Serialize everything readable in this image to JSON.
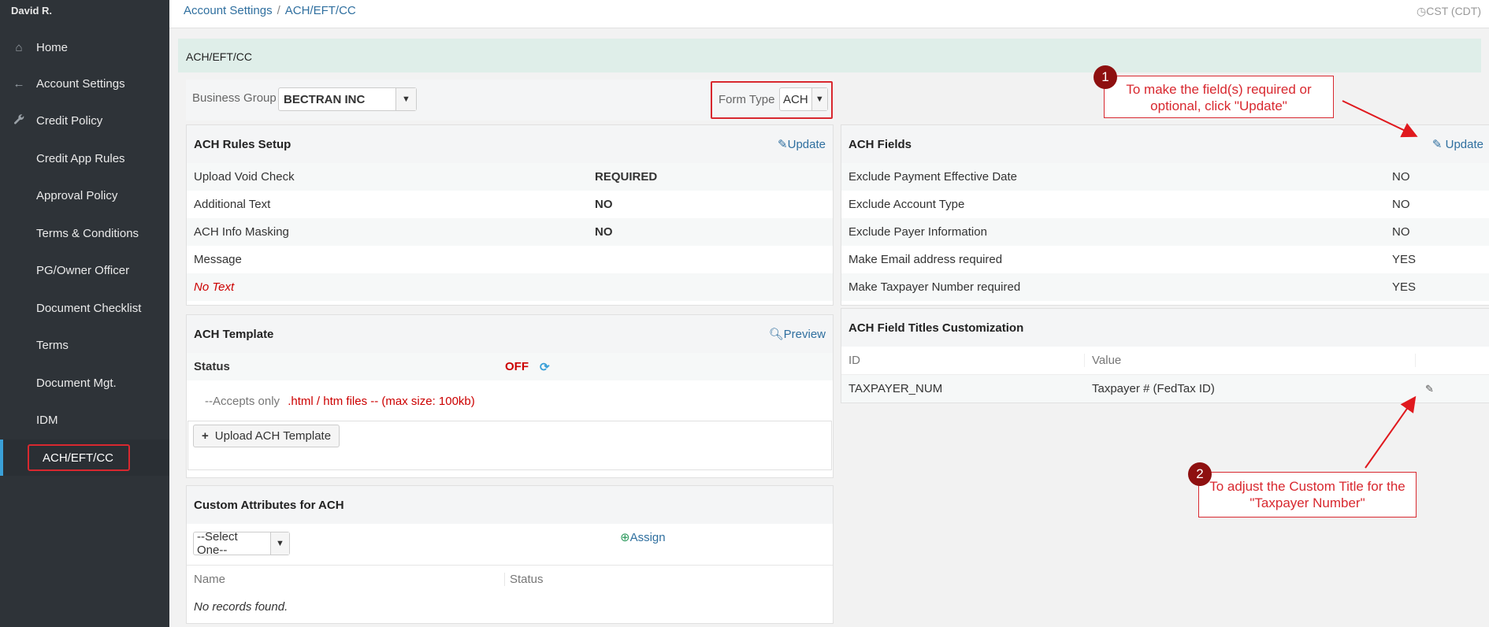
{
  "user": {
    "name": "David R."
  },
  "sidebar": {
    "items": [
      {
        "label": "Home",
        "icon": "home-icon"
      },
      {
        "label": "Account Settings",
        "icon": "arrow-left-icon"
      },
      {
        "label": "Credit Policy",
        "icon": "wrench-icon"
      },
      {
        "label": "Credit App Rules"
      },
      {
        "label": "Approval Policy"
      },
      {
        "label": "Terms & Conditions"
      },
      {
        "label": "PG/Owner Officer"
      },
      {
        "label": "Document Checklist"
      },
      {
        "label": "Terms"
      },
      {
        "label": "Document Mgt."
      },
      {
        "label": "IDM"
      },
      {
        "label": "ACH/EFT/CC"
      }
    ]
  },
  "breadcrumb": {
    "parent": "Account Settings",
    "separator": "/",
    "current": "ACH/EFT/CC"
  },
  "timezone": "CST (CDT)",
  "page_title": "ACH/EFT/CC",
  "filters": {
    "business_group_label": "Business Group",
    "business_group_value": "BECTRAN INC",
    "form_type_label": "Form Type",
    "form_type_value": "ACH"
  },
  "rules": {
    "title": "ACH Rules Setup",
    "update_label": "Update",
    "rows": [
      {
        "label": "Upload Void Check",
        "value": "REQUIRED"
      },
      {
        "label": "Additional Text",
        "value": "NO"
      },
      {
        "label": "ACH Info Masking",
        "value": "NO"
      },
      {
        "label": "Message",
        "value": ""
      }
    ],
    "message_text": "No Text"
  },
  "template": {
    "title": "ACH Template",
    "preview_label": "Preview",
    "status_label": "Status",
    "status_value": "OFF",
    "accepts_prefix": "--Accepts only",
    "accepts_rule": ".html / htm files -- (max size: 100kb)",
    "upload_label": "Upload ACH Template"
  },
  "custom_attributes": {
    "title": "Custom Attributes for ACH",
    "select_placeholder": "--Select One--",
    "assign_label": "Assign",
    "columns": [
      "Name",
      "Status"
    ],
    "empty_text": "No records found."
  },
  "fields": {
    "title": "ACH Fields",
    "update_label": "Update",
    "rows": [
      {
        "label": "Exclude Payment Effective Date",
        "value": "NO"
      },
      {
        "label": "Exclude Account Type",
        "value": "NO"
      },
      {
        "label": "Exclude Payer Information",
        "value": "NO"
      },
      {
        "label": "Make Email address required",
        "value": "YES"
      },
      {
        "label": "Make Taxpayer Number required",
        "value": "YES"
      }
    ]
  },
  "titles_custom": {
    "title": "ACH Field Titles Customization",
    "columns": [
      "ID",
      "Value"
    ],
    "rows": [
      {
        "id": "TAXPAYER_NUM",
        "value": "Taxpayer # (FedTax ID)"
      }
    ]
  },
  "callouts": [
    {
      "number": "1",
      "text": "To make the field(s) required or optional, click \"Update\""
    },
    {
      "number": "2",
      "text": "To adjust the Custom Title for the \"Taxpayer Number\""
    }
  ],
  "colors": {
    "accent": "#2f6f9f",
    "alert": "#d8282f",
    "sidebar": "#2e3338"
  }
}
